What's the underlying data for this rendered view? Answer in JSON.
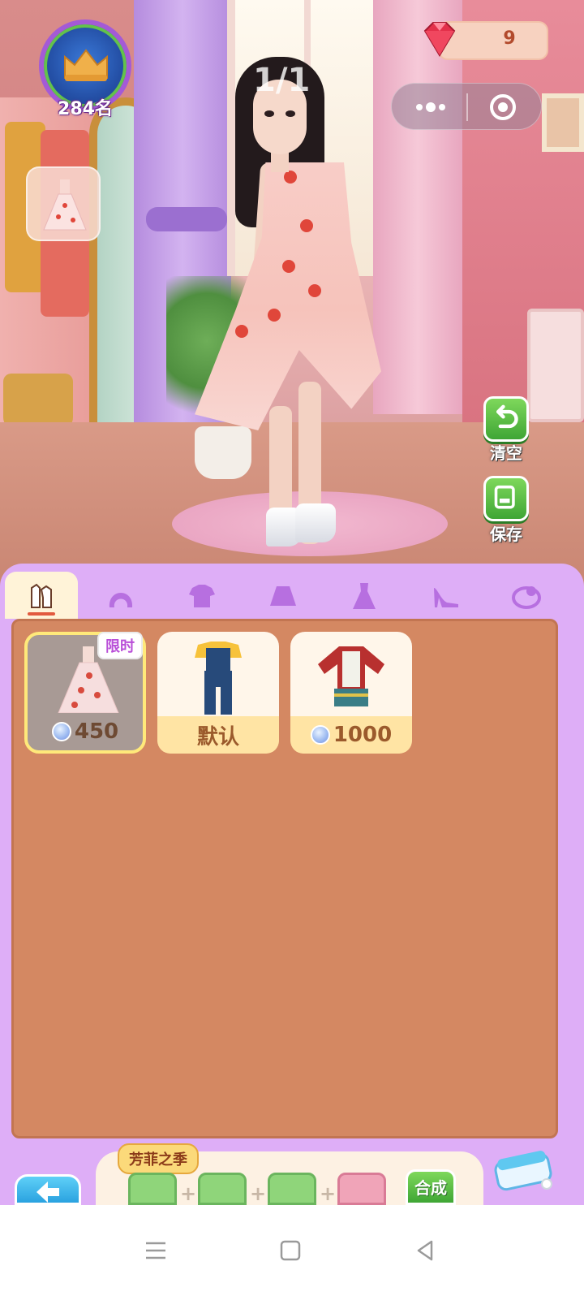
{
  "hud": {
    "rank": "284名",
    "gems": "9",
    "page_indicator": "1/1"
  },
  "side_buttons": {
    "clear_label": "清空",
    "save_label": "保存"
  },
  "tabs": [
    {
      "name": "outfit",
      "icon": "outfit-icon",
      "active": true
    },
    {
      "name": "hair",
      "icon": "hair-icon",
      "active": false
    },
    {
      "name": "top",
      "icon": "shirt-icon",
      "active": false
    },
    {
      "name": "skirt",
      "icon": "skirt-icon",
      "active": false
    },
    {
      "name": "dress",
      "icon": "dress-icon",
      "active": false
    },
    {
      "name": "shoes",
      "icon": "heel-icon",
      "active": false
    },
    {
      "name": "accessory",
      "icon": "accessory-icon",
      "active": false
    }
  ],
  "items": [
    {
      "name": "pink-floral-dress",
      "price": "450",
      "tag": "限时",
      "selected": true,
      "currency_icon": "shirt-coin-icon"
    },
    {
      "name": "denim-overalls",
      "price": "默认",
      "tag": "",
      "selected": false
    },
    {
      "name": "ethnic-costume",
      "price": "1000",
      "tag": "",
      "selected": false,
      "currency_icon": "shirt-coin-icon"
    }
  ],
  "season": {
    "label": "芳菲之季",
    "combine_label": "合成"
  },
  "colors": {
    "panel": "#deaef7",
    "grid": "#d48862",
    "accent_green": "#3fa635",
    "selected_border": "#ffe97a"
  }
}
